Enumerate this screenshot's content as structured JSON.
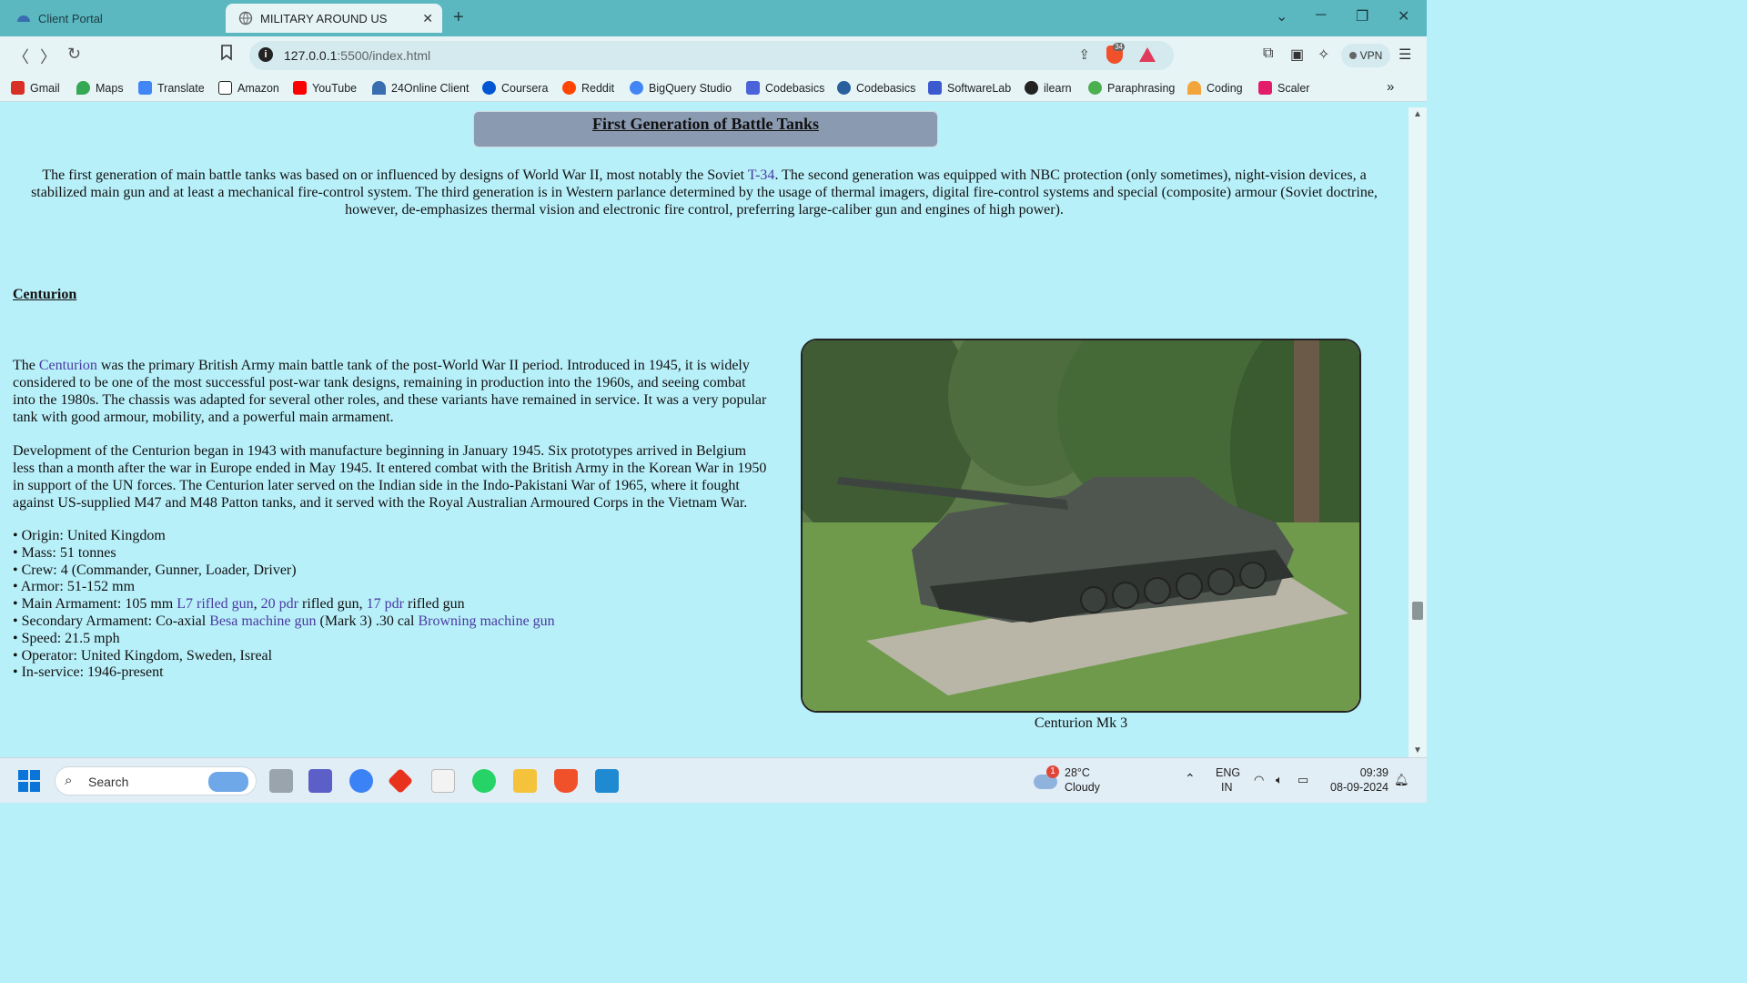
{
  "browser": {
    "tabs": [
      {
        "label": "Client Portal",
        "active": false
      },
      {
        "label": "MILITARY AROUND US",
        "active": true
      }
    ],
    "url_host": "127.0.0.1",
    "url_rest": ":5500/index.html",
    "shield_count": "34",
    "vpn_label": "VPN",
    "bookmarks": [
      {
        "label": "Gmail",
        "color": "#d93025"
      },
      {
        "label": "Maps",
        "color": "#34a853"
      },
      {
        "label": "Translate",
        "color": "#4285f4"
      },
      {
        "label": "Amazon",
        "color": "#222222"
      },
      {
        "label": "YouTube",
        "color": "#ff0000"
      },
      {
        "label": "24Online Client",
        "color": "#3a6db0"
      },
      {
        "label": "Coursera",
        "color": "#0056d2"
      },
      {
        "label": "Reddit",
        "color": "#ff4500"
      },
      {
        "label": "BigQuery Studio",
        "color": "#4285f4"
      },
      {
        "label": "Codebasics",
        "color": "#4a63d8"
      },
      {
        "label": "Codebasics",
        "color": "#2a5f9e"
      },
      {
        "label": "SoftwareLab",
        "color": "#3c5ad0"
      },
      {
        "label": "ilearn",
        "color": "#222222"
      },
      {
        "label": "Paraphrasing",
        "color": "#4caf50"
      },
      {
        "label": "Coding",
        "color": "#f2a53b"
      },
      {
        "label": "Scaler",
        "color": "#e21e6b"
      }
    ]
  },
  "page": {
    "header_title": "First Generation of Battle Tanks",
    "intro": {
      "before_link": "The first generation of main battle tanks was based on or influenced by designs of World War II, most notably the Soviet ",
      "link": "T-34",
      "after_link": ". The second generation was equipped with NBC protection (only sometimes), night-vision devices, a stabilized main gun and at least a mechanical fire-control system. The third generation is in Western parlance determined by the usage of thermal imagers, digital fire-control systems and special (composite) armour (Soviet doctrine, however, de-emphasizes thermal vision and electronic fire control, preferring large-caliber gun and engines of high power)."
    },
    "section_title": "Centurion",
    "para1": {
      "before_link": "The ",
      "link": "Centurion",
      "after_link": " was the primary British Army main battle tank of the post-World War II period. Introduced in 1945, it is widely considered to be one of the most successful post-war tank designs, remaining in production into the 1960s, and seeing combat into the 1980s. The chassis was adapted for several other roles, and these variants have remained in service. It was a very popular tank with good armour, mobility, and a powerful main armament."
    },
    "para2": "Development of the Centurion began in 1943 with manufacture beginning in January 1945. Six prototypes arrived in Belgium less than a month after the war in Europe ended in May 1945. It entered combat with the British Army in the Korean War in 1950 in support of the UN forces. The Centurion later served on the Indian side in the Indo-Pakistani War of 1965, where it fought against US-supplied M47 and M48 Patton tanks, and it served with the Royal Australian Armoured Corps in the Vietnam War.",
    "specs": {
      "origin": "• Origin: United Kingdom",
      "mass": "• Mass: 51 tonnes",
      "crew": "• Crew: 4 (Commander, Gunner, Loader, Driver)",
      "armor": "• Armor: 51-152 mm",
      "main_prefix": "• Main Armament: 105 mm ",
      "main_link1": "L7 rifled gun",
      "main_sep1": ", ",
      "main_link2": "20 pdr",
      "main_mid": " rifled gun, ",
      "main_link3": "17 pdr",
      "main_suffix": " rifled gun",
      "secondary_prefix": "• Secondary Armament: Co-axial ",
      "secondary_link1": "Besa machine gun",
      "secondary_mid": " (Mark 3) .30 cal ",
      "secondary_link2": "Browning machine gun",
      "speed": "• Speed: 21.5 mph",
      "operator": "• Operator: United Kingdom, Sweden, Isreal",
      "in_service": "• In-service: 1946-present"
    },
    "image_caption": "Centurion Mk 3"
  },
  "taskbar": {
    "search_label": "Search",
    "weather_badge": "1",
    "weather_temp": "28°C",
    "weather_desc": "Cloudy",
    "lang_top": "ENG",
    "lang_bottom": "IN",
    "time": "09:39",
    "date": "08-09-2024"
  }
}
